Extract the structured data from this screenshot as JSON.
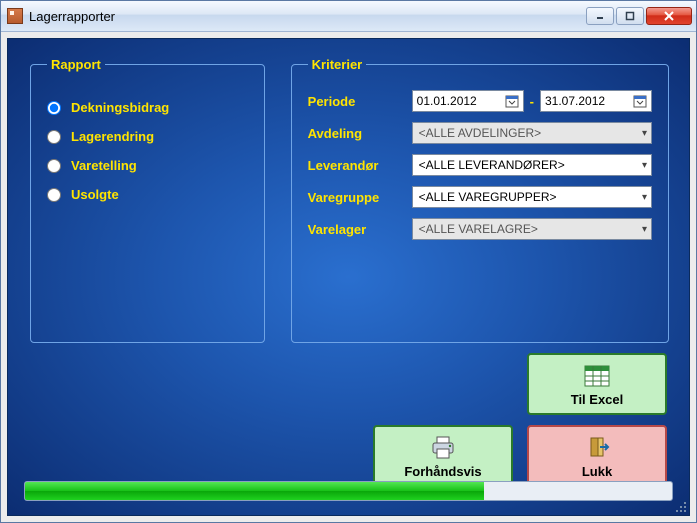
{
  "window": {
    "title": "Lagerrapporter"
  },
  "rapport": {
    "legend": "Rapport",
    "options": [
      {
        "label": "Dekningsbidrag",
        "selected": true
      },
      {
        "label": "Lagerendring",
        "selected": false
      },
      {
        "label": "Varetelling",
        "selected": false
      },
      {
        "label": "Usolgte",
        "selected": false
      }
    ]
  },
  "kriterier": {
    "legend": "Kriterier",
    "periode_label": "Periode",
    "periode_from": "01.01.2012",
    "periode_sep": "-",
    "periode_to": "31.07.2012",
    "avdeling_label": "Avdeling",
    "avdeling_value": "<ALLE AVDELINGER>",
    "leverandor_label": "Leverandør",
    "leverandor_value": "<ALLE LEVERANDØRER>",
    "varegruppe_label": "Varegruppe",
    "varegruppe_value": "<ALLE VAREGRUPPER>",
    "varelager_label": "Varelager",
    "varelager_value": "<ALLE VARELAGRE>"
  },
  "buttons": {
    "excel": "Til Excel",
    "preview": "Forhåndsvis",
    "close": "Lukk"
  },
  "progress": {
    "percent": 71
  }
}
